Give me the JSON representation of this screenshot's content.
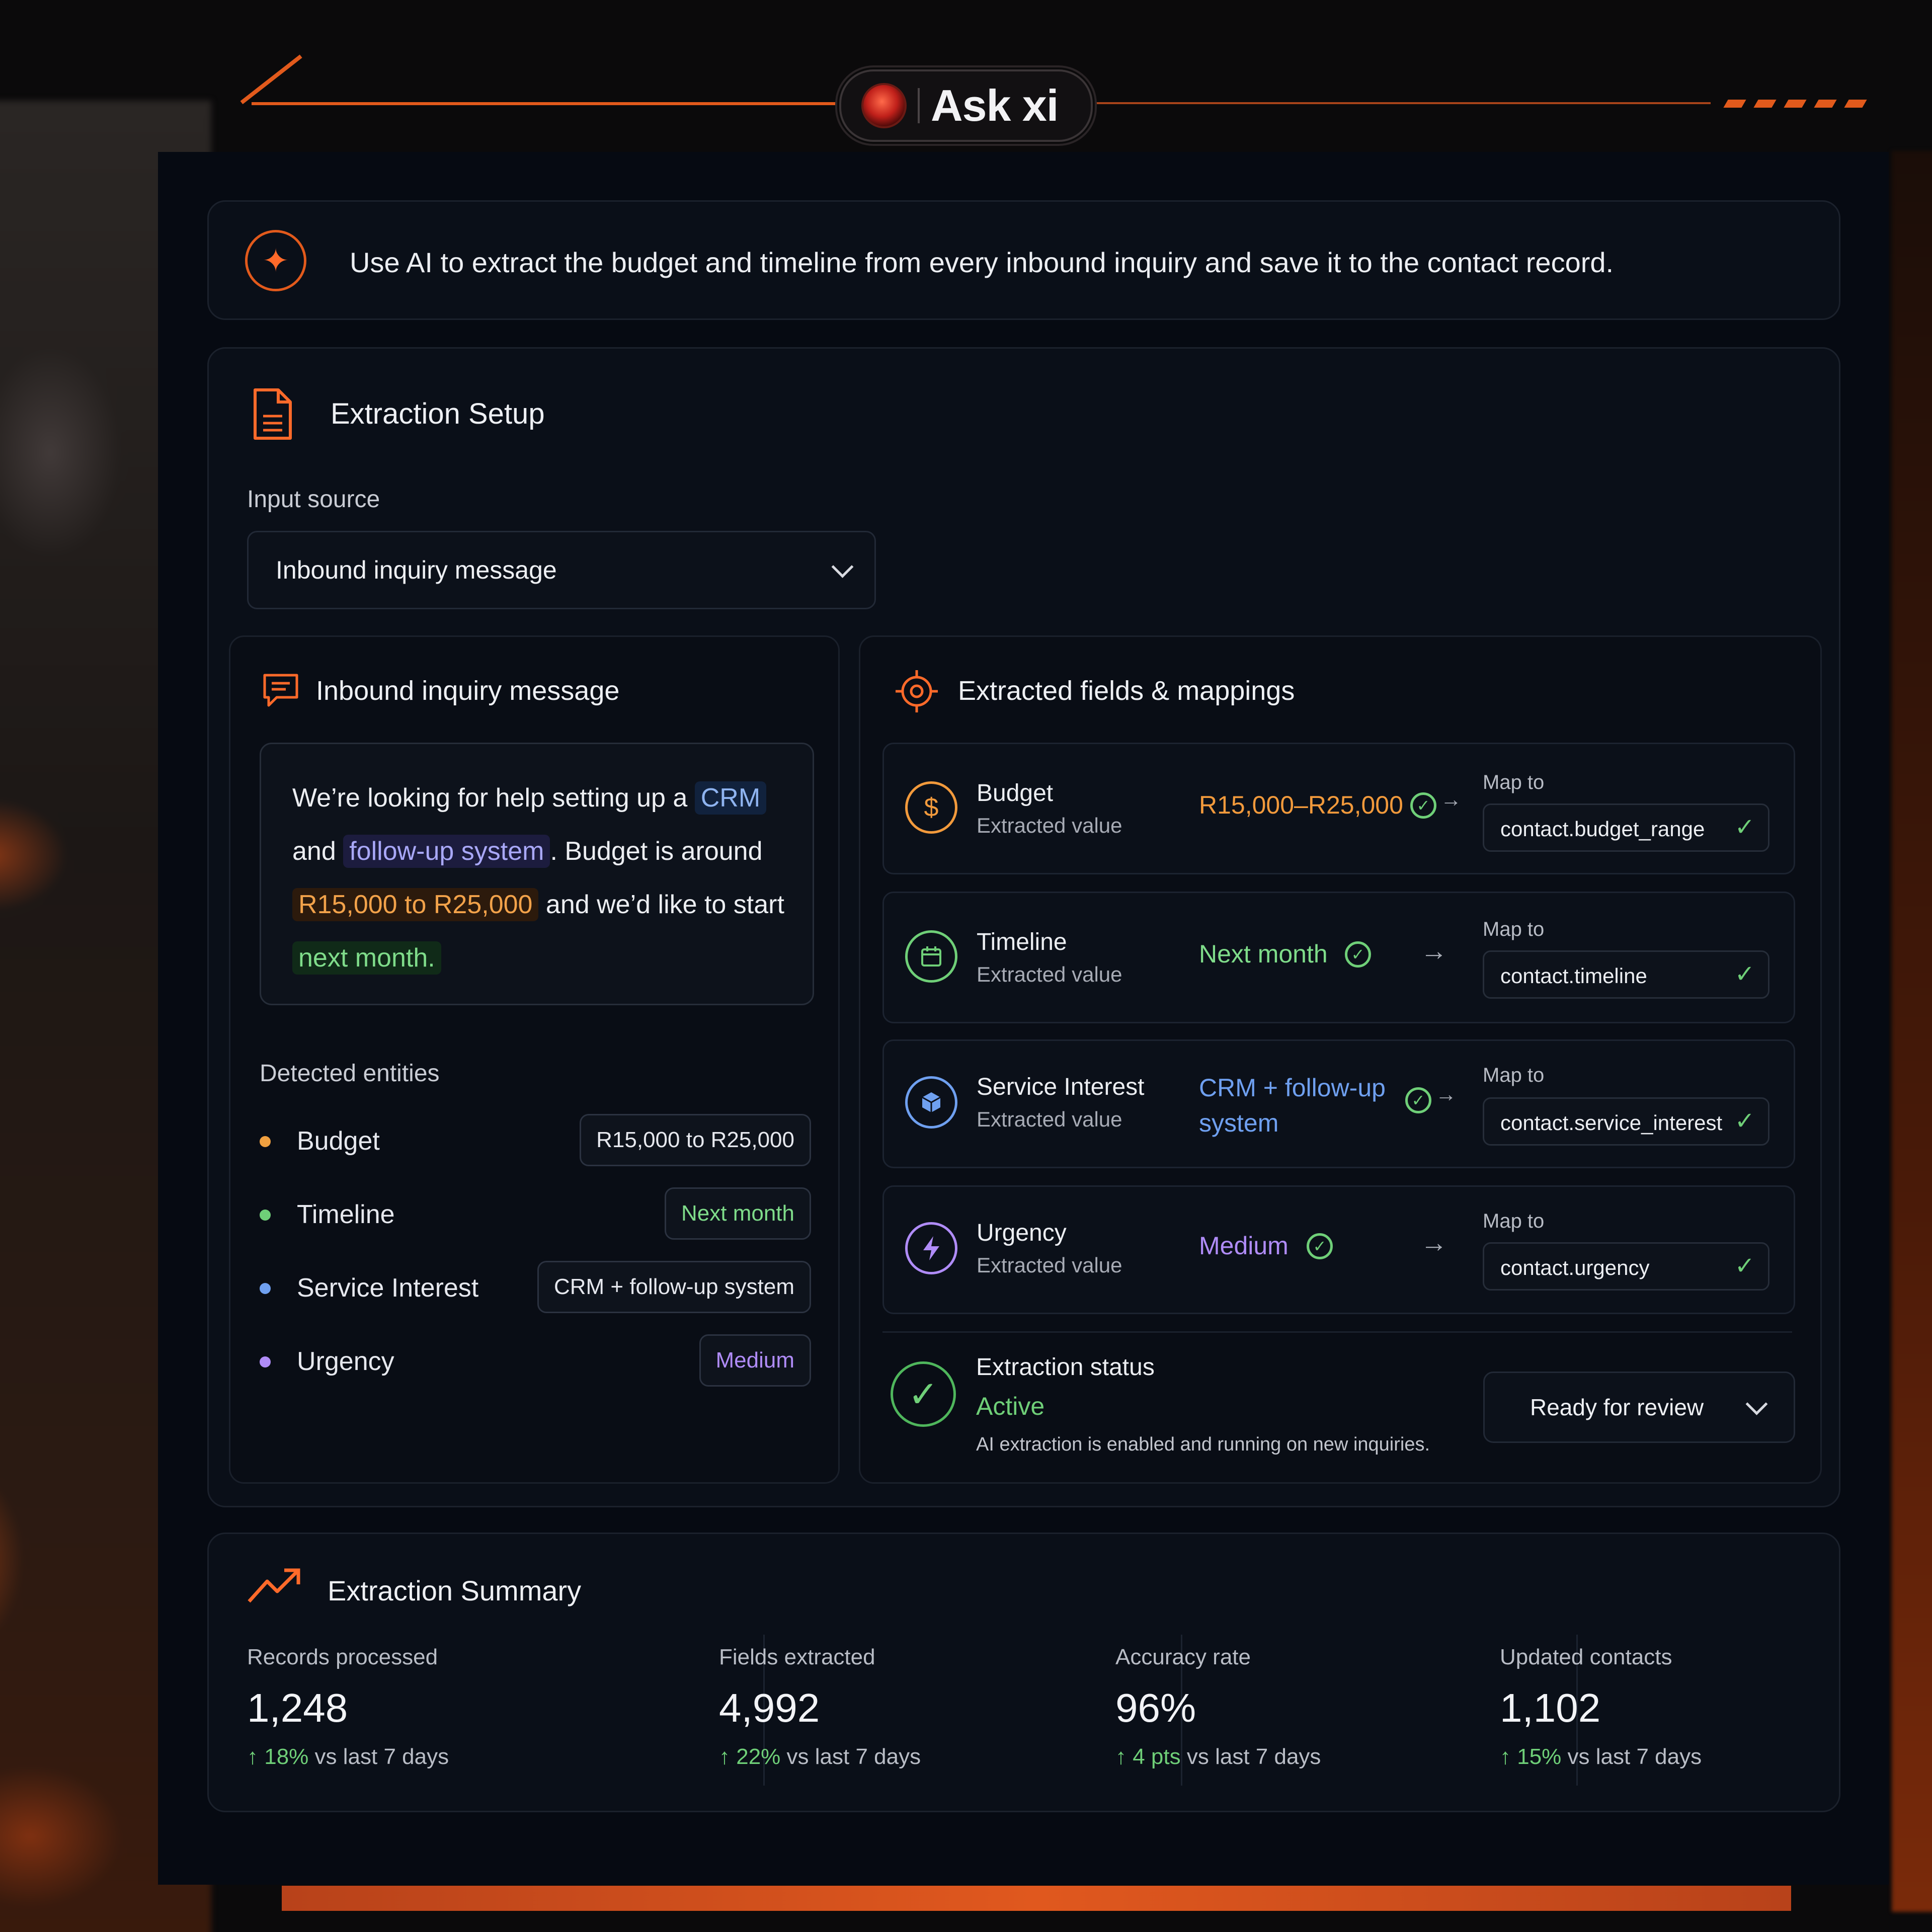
{
  "app": {
    "name": "Ask xi"
  },
  "prompt": {
    "text": "Use AI to extract the budget and timeline from every inbound inquiry and save it to the contact record."
  },
  "setup": {
    "title": "Extraction Setup",
    "input_source_label": "Input source",
    "input_source_value": "Inbound inquiry message"
  },
  "inquiry": {
    "title": "Inbound inquiry message",
    "message": {
      "p1": "We’re looking for help setting up a ",
      "crm": "CRM",
      "p2": " and ",
      "followup": "follow-up system",
      "p3": ". Budget is around ",
      "budget": "R15,000 to R25,000",
      "p4": " and we’d like to start ",
      "timeline": "next month."
    },
    "detected_label": "Detected entities",
    "entities": [
      {
        "name": "Budget",
        "value": "R15,000 to R25,000",
        "color": "#f0a040"
      },
      {
        "name": "Timeline",
        "value": "Next month",
        "color": "#6fcf78"
      },
      {
        "name": "Service Interest",
        "value": "CRM + follow-up system",
        "color": "#6fa0f0"
      },
      {
        "name": "Urgency",
        "value": "Medium",
        "color": "#b08cf8"
      }
    ]
  },
  "fields": {
    "title": "Extracted fields & mappings",
    "extracted_value_label": "Extracted value",
    "map_to_label": "Map to",
    "rows": [
      {
        "name": "Budget",
        "value": "R15,000–R25,000",
        "icon": "dollar-icon",
        "color": "#f29a3c",
        "map": "contact.budget_range"
      },
      {
        "name": "Timeline",
        "value": "Next month",
        "icon": "calendar-icon",
        "color": "#7fdc8a",
        "map": "contact.timeline"
      },
      {
        "name": "Service Interest",
        "value": "CRM + follow-up system",
        "icon": "cube-icon",
        "color": "#6fa0f0",
        "map": "contact.service_interest"
      },
      {
        "name": "Urgency",
        "value": "Medium",
        "icon": "bolt-icon",
        "color": "#b08cf8",
        "map": "contact.urgency"
      }
    ],
    "status": {
      "label": "Extraction status",
      "value": "Active",
      "description": "AI extraction is enabled and running on new inquiries.",
      "select_value": "Ready for review"
    }
  },
  "summary": {
    "title": "Extraction Summary",
    "delta_suffix": "vs last 7 days",
    "stats": [
      {
        "label": "Records processed",
        "value": "1,248",
        "delta": "18%"
      },
      {
        "label": "Fields extracted",
        "value": "4,992",
        "delta": "22%"
      },
      {
        "label": "Accuracy rate",
        "value": "96%",
        "delta": "4 pts"
      },
      {
        "label": "Updated contacts",
        "value": "1,102",
        "delta": "15%"
      }
    ]
  },
  "colors": {
    "accent": "#e25a1c",
    "success": "#6fcf78",
    "panel": "#060a12"
  }
}
